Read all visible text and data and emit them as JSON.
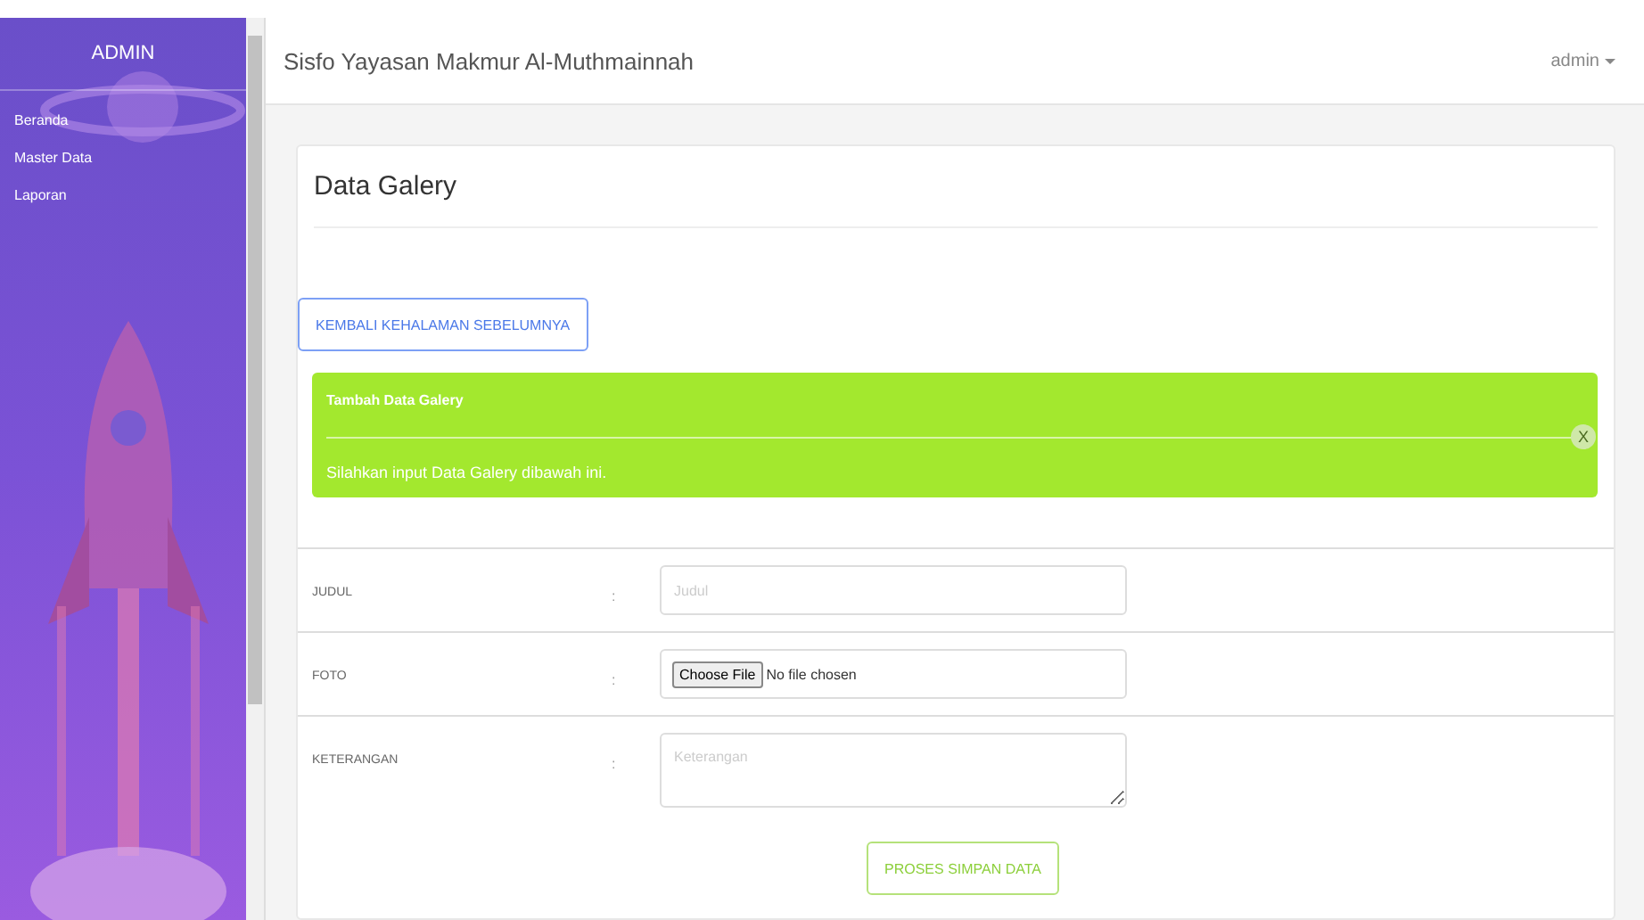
{
  "sidebar": {
    "title": "ADMIN",
    "items": [
      {
        "label": "Beranda"
      },
      {
        "label": "Master Data"
      },
      {
        "label": "Laporan"
      }
    ]
  },
  "header": {
    "title": "Sisfo Yayasan Makmur Al-Muthmainnah",
    "user": "admin"
  },
  "card": {
    "title": "Data Galery",
    "back_button": "KEMBALI KEHALAMAN SEBELUMNYA",
    "alert": {
      "title": "Tambah Data Galery",
      "message": "Silahkan input Data Galery dibawah ini.",
      "close": "X"
    },
    "form": [
      {
        "kind": "text",
        "label": "JUDUL",
        "separator": ":",
        "placeholder": "Judul"
      },
      {
        "kind": "file",
        "label": "FOTO",
        "separator": ":",
        "button": "Choose File",
        "status": "No file chosen"
      },
      {
        "kind": "textarea",
        "label": "KETERANGAN",
        "separator": ":",
        "placeholder": "Keterangan"
      }
    ],
    "submit": "PROSES SIMPAN DATA"
  }
}
